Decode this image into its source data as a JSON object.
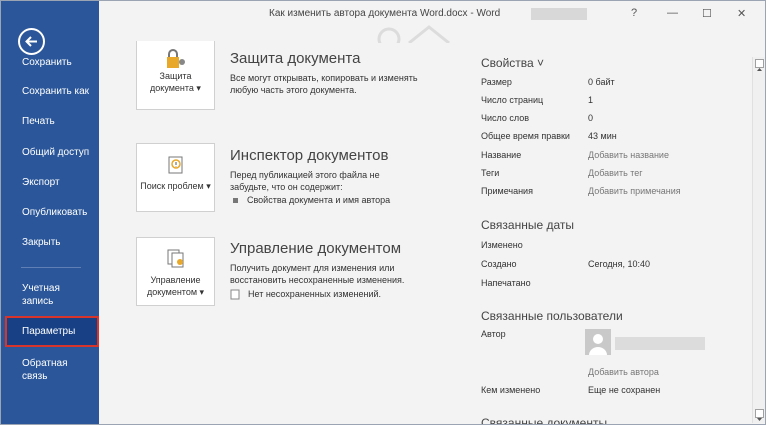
{
  "window": {
    "title": "Как изменить автора документа Word.docx - Word",
    "help": "?",
    "minimize": "—",
    "maximize": "☐",
    "close": "✕"
  },
  "sidebar": {
    "items": [
      {
        "label": "Сохранить"
      },
      {
        "label": "Сохранить как"
      },
      {
        "label": "Печать"
      },
      {
        "label": "Общий доступ"
      },
      {
        "label": "Экспорт"
      },
      {
        "label": "Опубликовать"
      },
      {
        "label": "Закрыть"
      },
      {
        "label": "Учетная запись"
      },
      {
        "label": "Параметры"
      },
      {
        "label": "Обратная связь"
      }
    ],
    "selected_index": 8,
    "bg_color": "#2b579a",
    "highlight_color": "#d9342b"
  },
  "sections": {
    "protect": {
      "button_label": "Защита документа ▾",
      "title": "Защита документа",
      "desc": "Все могут открывать, копировать и изменять любую часть этого документа."
    },
    "inspect": {
      "button_label": "Поиск проблем ▾",
      "title": "Инспектор документов",
      "desc": "Перед публикацией этого файла не забудьте, что он содержит:",
      "bullet": "Свойства документа и имя автора"
    },
    "manage": {
      "button_label": "Управление документом ▾",
      "title": "Управление документом",
      "desc": "Получить документ для изменения или восстановить несохраненные изменения.",
      "note": "Нет несохраненных изменений."
    }
  },
  "properties": {
    "header": "Свойства ˅",
    "rows": [
      {
        "label": "Размер",
        "value": "0 байт"
      },
      {
        "label": "Число страниц",
        "value": "1"
      },
      {
        "label": "Число слов",
        "value": "0"
      },
      {
        "label": "Общее время правки",
        "value": "43 мин"
      },
      {
        "label": "Название",
        "value": "Добавить название"
      },
      {
        "label": "Теги",
        "value": "Добавить тег"
      },
      {
        "label": "Примечания",
        "value": "Добавить примечания"
      }
    ],
    "dates_header": "Связанные даты",
    "dates": [
      {
        "label": "Изменено",
        "value": ""
      },
      {
        "label": "Создано",
        "value": "Сегодня, 10:40"
      },
      {
        "label": "Напечатано",
        "value": ""
      }
    ],
    "people_header": "Связанные пользователи",
    "author_label": "Автор",
    "add_author": "Добавить автора",
    "modified_by_label": "Кем изменено",
    "modified_by_value": "Еще не сохранен",
    "docs_header": "Связанные документы"
  }
}
